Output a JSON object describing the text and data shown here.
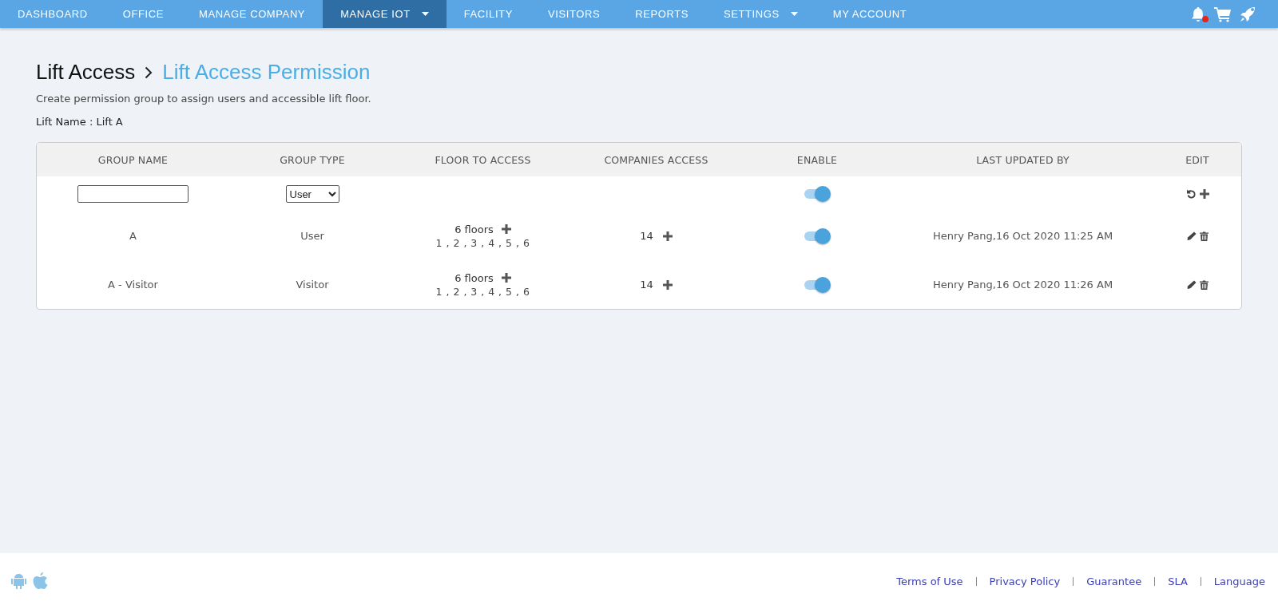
{
  "nav": {
    "items": [
      {
        "label": "DASHBOARD",
        "selected": false,
        "has_menu": false
      },
      {
        "label": "OFFICE",
        "selected": false,
        "has_menu": false
      },
      {
        "label": "MANAGE COMPANY",
        "selected": false,
        "has_menu": false
      },
      {
        "label": "MANAGE IOT",
        "selected": true,
        "has_menu": true
      },
      {
        "label": "FACILITY",
        "selected": false,
        "has_menu": false
      },
      {
        "label": "VISITORS",
        "selected": false,
        "has_menu": false
      },
      {
        "label": "REPORTS",
        "selected": false,
        "has_menu": false
      },
      {
        "label": "SETTINGS",
        "selected": false,
        "has_menu": true
      },
      {
        "label": "MY ACCOUNT",
        "selected": false,
        "has_menu": false
      }
    ],
    "unread_notifications": true
  },
  "breadcrumb": [
    {
      "label": "Lift Access"
    },
    {
      "label": "Lift Access Permission"
    }
  ],
  "description": "Create permission group to assign users and accessible lift floor.",
  "lift_name": "Lift Name : Lift A",
  "table": {
    "columns": [
      "GROUP NAME",
      "GROUP TYPE",
      "FLOOR TO ACCESS",
      "COMPANIES ACCESS",
      "ENABLE",
      "LAST UPDATED BY",
      "EDIT"
    ],
    "new_row": {
      "group_type": "User",
      "enabled": true
    },
    "rows": [
      {
        "group_name": "A",
        "group_type": "User",
        "floors": "6 floors",
        "floor_list": "1 , 2 , 3 , 4 , 5 , 6",
        "companies": "14",
        "enabled": true,
        "last_updated_by": "Henry Pang,16 Oct 2020 11:25 AM"
      },
      {
        "group_name": "A - Visitor",
        "group_type": "Visitor",
        "floors": "6 floors",
        "floor_list": "1 , 2 , 3 , 4 , 5 , 6",
        "companies": "14",
        "enabled": true,
        "last_updated_by": "Henry Pang,16 Oct 2020 11:26 AM"
      }
    ]
  },
  "footer": {
    "links": [
      "Terms of Use",
      "Privacy Policy",
      "Guarantee",
      "SLA",
      "Language"
    ]
  }
}
